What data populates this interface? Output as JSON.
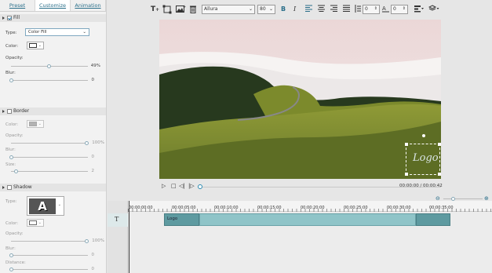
{
  "tabs": [
    {
      "label": "Preset"
    },
    {
      "label": "Customize"
    },
    {
      "label": "Animation"
    }
  ],
  "fill": {
    "header": "Fill",
    "type_label": "Type:",
    "type_value": "Color Fill",
    "color_label": "Color:",
    "opacity_label": "Opacity:",
    "opacity_value": "49%",
    "blur_label": "Blur:",
    "blur_value": "0"
  },
  "border": {
    "header": "Border",
    "color_label": "Color:",
    "opacity_label": "Opacity:",
    "opacity_value": "100%",
    "blur_label": "Blur:",
    "blur_value": "0",
    "size_label": "Size:",
    "size_value": "2"
  },
  "shadow": {
    "header": "Shadow",
    "type_label": "Type:",
    "type_glyph": "A",
    "color_label": "Color:",
    "opacity_label": "Opacity:",
    "opacity_value": "100%",
    "blur_label": "Blur:",
    "blur_value": "0",
    "distance_label": "Distance:",
    "distance_value": "0"
  },
  "toolbar": {
    "font": "Allura",
    "size": "80",
    "bold": "B",
    "italic": "I",
    "spacing1": "0",
    "spacing2": "0"
  },
  "preview": {
    "logo_text": "Logo",
    "time": "00:00:00 / 00:00:42"
  },
  "timeline": {
    "track_icon": "T",
    "clip_label": "Logo",
    "ruler": [
      "00:00:00:00",
      "00:00:05:00",
      "00:00:10:00",
      "00:00:15:00",
      "00:00:20:00",
      "00:00:25:00",
      "00:00:30:00",
      "00:00:35:00"
    ]
  },
  "colors": {
    "accent": "#2a6f8a",
    "clip": "#8fc4c8",
    "clip_dark": "#5e9aa0"
  }
}
